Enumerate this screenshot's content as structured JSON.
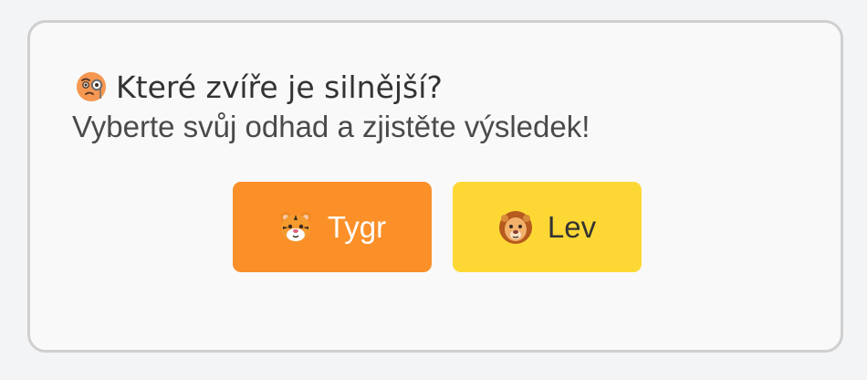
{
  "quiz": {
    "question_icon": "face-with-monocle-icon",
    "question": "Které zvíře je silnější?",
    "subtitle": "Vyberte svůj odhad a zjistěte výsledek!",
    "options": [
      {
        "icon": "tiger-face-icon",
        "label": "Tygr",
        "color": "#fb9029",
        "text_color": "#ffffff"
      },
      {
        "icon": "lion-face-icon",
        "label": "Lev",
        "color": "#fdd835",
        "text_color": "#333333"
      }
    ]
  }
}
